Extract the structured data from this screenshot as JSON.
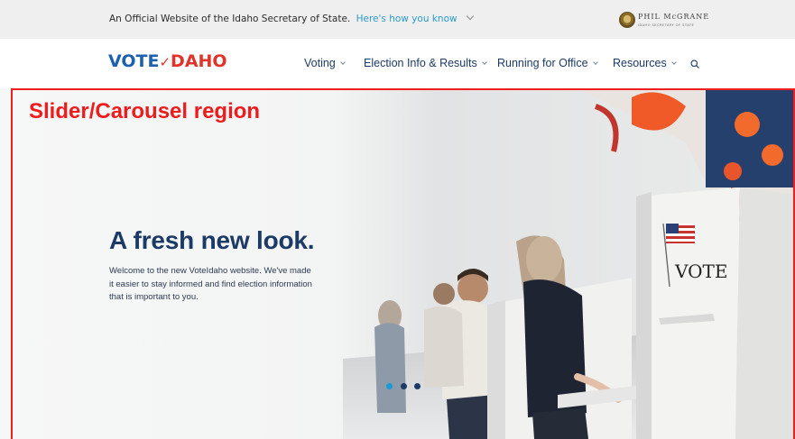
{
  "official_banner": {
    "text": "An Official Website of the Idaho Secretary of State.",
    "link": "Here's how you know",
    "sos_name": "PHIL McGRANE",
    "sos_title": "IDAHO SECRETARY OF STATE"
  },
  "nav": {
    "logo_vote": "VOTE",
    "logo_idaho": "DAHO",
    "items": [
      {
        "label": "Voting"
      },
      {
        "label": "Election Info & Results"
      },
      {
        "label": "Running for Office"
      },
      {
        "label": "Resources"
      }
    ]
  },
  "hero": {
    "region_label": "Slider/Carousel region",
    "title": "A fresh new look.",
    "body": "Welcome to the new VoteIdaho website. We've made it easier to stay informed and find election information that is important to you.",
    "booth_sign": "VOTE",
    "slide_count": 3,
    "active_slide": 1
  },
  "colors": {
    "brand_blue": "#1d5fb1",
    "brand_red": "#e0342a",
    "link_blue": "#2b9cc9",
    "heading_navy": "#1c3a66",
    "annotation_red": "#ee1c1c",
    "dot_active": "#1a9bd7",
    "dot_inactive": "#1c3a66"
  },
  "icons": {
    "search": "search-icon",
    "chevron": "chevron-down-icon",
    "seal": "state-seal-icon"
  }
}
